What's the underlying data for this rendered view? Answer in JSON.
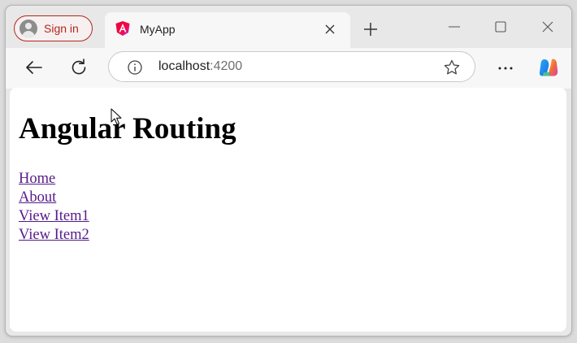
{
  "profile": {
    "signin_label": "Sign in"
  },
  "tab": {
    "title": "MyApp",
    "favicon": "angular-icon"
  },
  "address_bar": {
    "host": "localhost",
    "port": ":4200"
  },
  "page": {
    "heading": "Angular Routing",
    "nav_links": [
      {
        "label": "Home"
      },
      {
        "label": "About"
      },
      {
        "label": "View Item1"
      },
      {
        "label": "View Item2"
      }
    ]
  },
  "colors": {
    "signin_accent": "#b3261e",
    "visited_link": "#551a8b",
    "tab_active": "#f7f7f7",
    "chrome_bg": "#e8e8e8"
  },
  "icons": [
    "person-icon",
    "angular-icon",
    "close-icon",
    "plus-icon",
    "minimize-icon",
    "maximize-icon",
    "window-close-icon",
    "back-arrow-icon",
    "reload-icon",
    "info-icon",
    "star-icon",
    "more-icon",
    "copilot-icon",
    "mouse-cursor-icon"
  ]
}
